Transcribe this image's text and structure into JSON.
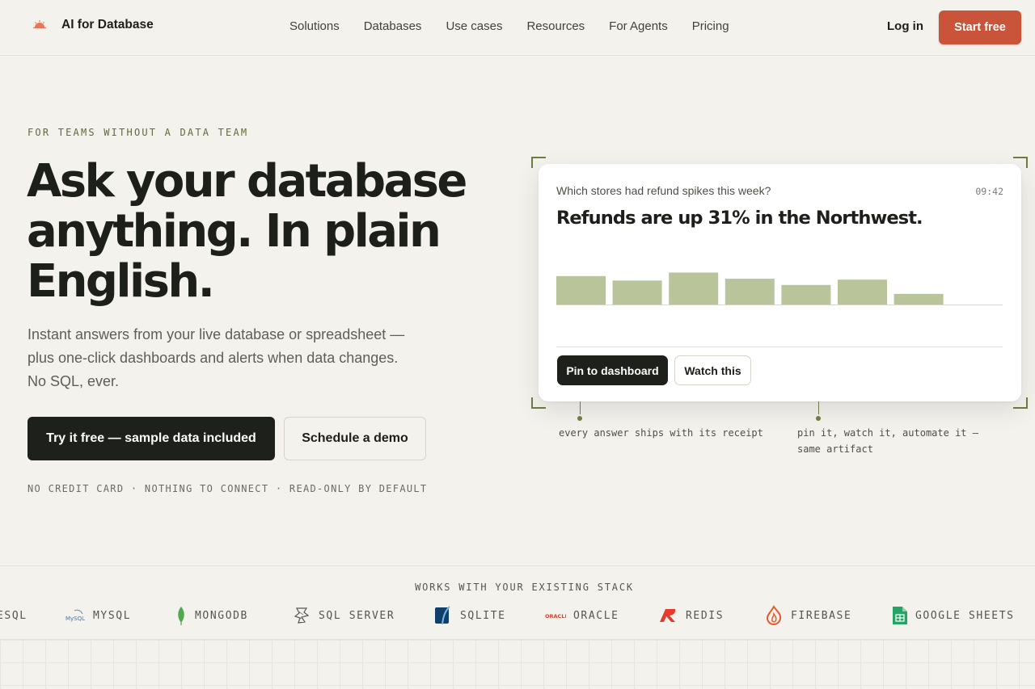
{
  "nav": {
    "brand": "AI for Database",
    "links": [
      "Solutions",
      "Databases",
      "Use cases",
      "Resources",
      "For Agents",
      "Pricing"
    ],
    "login": "Log in",
    "cta": "Start free"
  },
  "hero": {
    "eyebrow": "FOR TEAMS WITHOUT A DATA TEAM",
    "headline_lines": [
      "Ask your database",
      "anything. In plain",
      "English."
    ],
    "subtitle": "Instant answers from your live database or spreadsheet — plus one-click dashboards and alerts when data changes. No SQL, ever.",
    "primary_cta": "Try it free — sample data included",
    "secondary_cta": "Schedule a demo",
    "fineprint": "NO CREDIT CARD · NOTHING TO CONNECT · READ-ONLY BY DEFAULT"
  },
  "card": {
    "question": "Which stores had refund spikes this week?",
    "time": "09:42",
    "answer": "Refunds are up 31% in the Northwest.",
    "pin_button": "Pin to dashboard",
    "watch_button": "Watch this"
  },
  "chart_data": {
    "type": "bar",
    "series": [
      {
        "values": [
          32,
          27,
          36,
          29,
          22,
          28,
          12
        ]
      }
    ],
    "color": "#b9c49a"
  },
  "callouts": {
    "left": "every answer ships with its receipt",
    "right": "pin it, watch it, automate it — same artifact"
  },
  "stack": {
    "title": "WORKS WITH YOUR EXISTING STACK",
    "logos": [
      {
        "name": "ESQL",
        "icon": "postgresql-icon"
      },
      {
        "name": "MYSQL",
        "icon": "mysql-icon",
        "mark": "MySQL"
      },
      {
        "name": "MONGODB",
        "icon": "mongodb-leaf-icon"
      },
      {
        "name": "SQL SERVER",
        "icon": "sql-server-icon"
      },
      {
        "name": "SQLITE",
        "icon": "sqlite-icon"
      },
      {
        "name": "ORACLE",
        "icon": "oracle-icon",
        "mark": "ORACLE"
      },
      {
        "name": "REDIS",
        "icon": "redis-icon"
      },
      {
        "name": "FIREBASE",
        "icon": "firebase-icon"
      },
      {
        "name": "GOOGLE SHEETS",
        "icon": "google-sheets-icon"
      }
    ]
  },
  "colors": {
    "accent": "#c9543a",
    "dark": "#1e201b",
    "olive": "#6f7d43",
    "background": "#f4f2ed"
  }
}
